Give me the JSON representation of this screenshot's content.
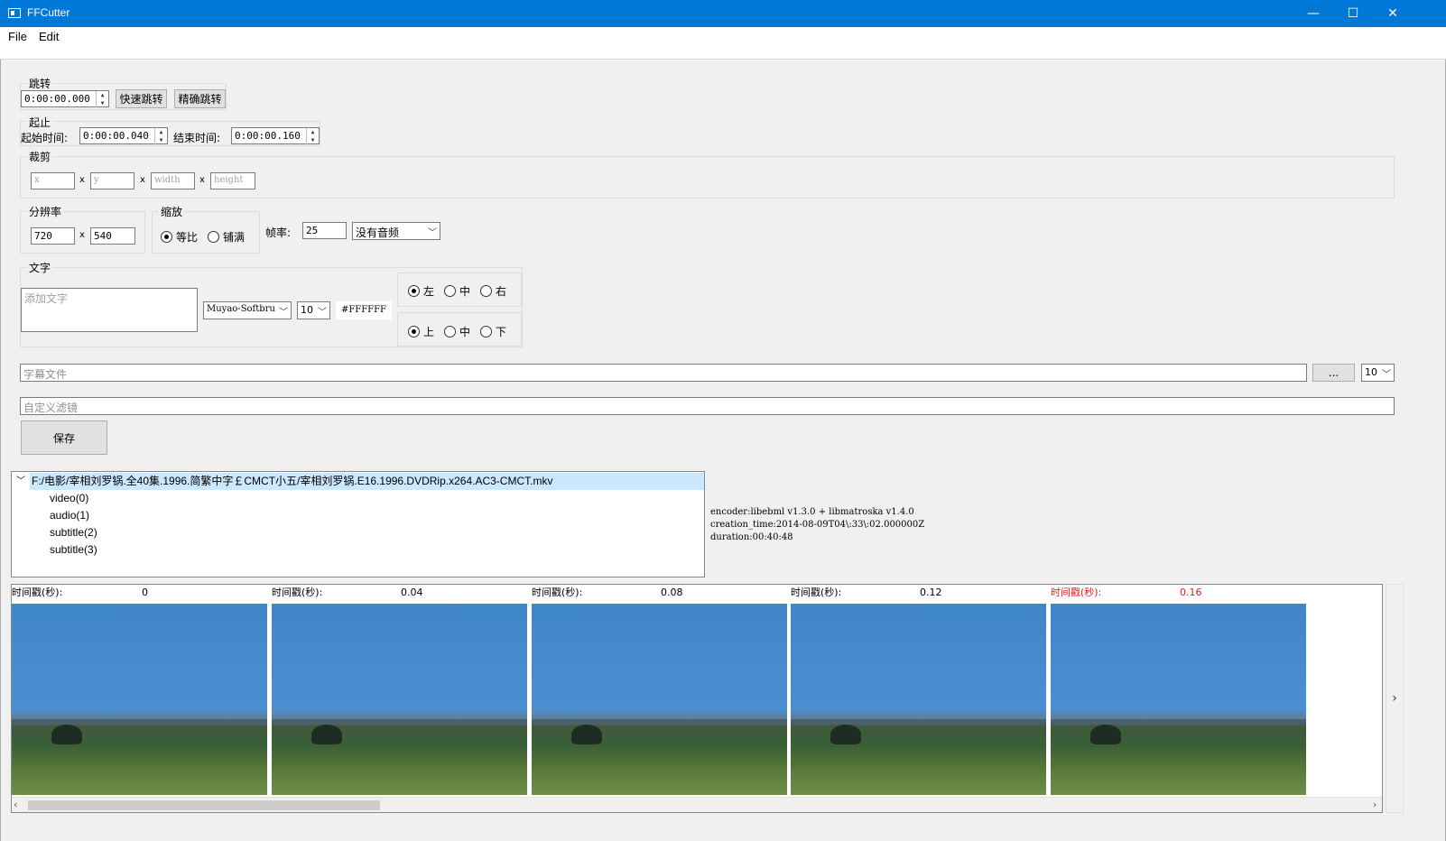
{
  "window": {
    "title": "FFCutter",
    "minimize": "—",
    "maximize": "☐",
    "close": "✕"
  },
  "menu": {
    "file": "File",
    "edit": "Edit"
  },
  "jump": {
    "group_title": "跳转",
    "time_value": "0:00:00.000",
    "fast_button": "快速跳转",
    "precise_button": "精确跳转"
  },
  "range": {
    "group_title": "起止",
    "start_label": "起始时间:",
    "start_value": "0:00:00.040",
    "end_label": "结束时间:",
    "end_value": "0:00:00.160"
  },
  "crop": {
    "group_title": "裁剪",
    "x_placeholder": "x",
    "y_placeholder": "y",
    "width_placeholder": "width",
    "height_placeholder": "height",
    "sep": "x"
  },
  "resolution": {
    "group_title": "分辨率",
    "width": "720",
    "sep": "x",
    "height": "540"
  },
  "scale": {
    "group_title": "缩放",
    "option_keep": "等比",
    "option_fill": "铺满",
    "selected": "等比"
  },
  "fps": {
    "label": "帧率:",
    "value": "25"
  },
  "audio": {
    "selected": "没有音频"
  },
  "text": {
    "group_title": "文字",
    "placeholder": "添加文字",
    "font": "Muyao-Softbru",
    "size": "10",
    "color": "#FFFFFF",
    "h_align": [
      "左",
      "中",
      "右"
    ],
    "h_selected": "左",
    "v_align": [
      "上",
      "中",
      "下"
    ],
    "v_selected": "上"
  },
  "subtitle": {
    "placeholder": "字幕文件",
    "browse_button": "...",
    "size": "10"
  },
  "filter": {
    "placeholder": "自定义滤镜"
  },
  "save_button": "保存",
  "file_tree": {
    "root": "F:/电影/宰相刘罗锅.全40集.1996.简繁中字￡CMCT小五/宰相刘罗锅.E16.1996.DVDRip.x264.AC3-CMCT.mkv",
    "streams": [
      "video(0)",
      "audio(1)",
      "subtitle(2)",
      "subtitle(3)"
    ]
  },
  "metadata": [
    "encoder:libebml v1.3.0 + libmatroska v1.4.0",
    "creation_time:2014-08-09T04\\:33\\:02.000000Z",
    "duration:00:40:48"
  ],
  "frames": {
    "label": "时间戳(秒):",
    "items": [
      {
        "time": "0",
        "selected": false
      },
      {
        "time": "0.04",
        "selected": false
      },
      {
        "time": "0.08",
        "selected": false
      },
      {
        "time": "0.12",
        "selected": false
      },
      {
        "time": "0.16",
        "selected": true
      },
      {
        "time": "",
        "selected": false
      }
    ],
    "next_arrow": "›",
    "colors": {
      "selected": "#e02020",
      "normal": "#000000"
    }
  },
  "accent": "#0078d7"
}
